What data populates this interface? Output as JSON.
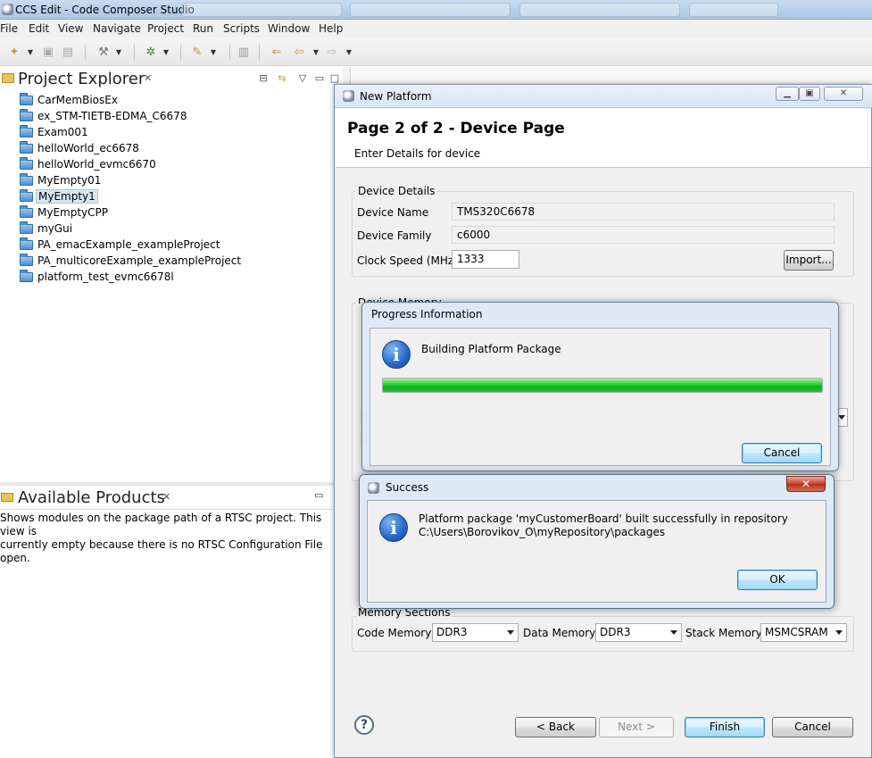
{
  "window": {
    "title": "CCS Edit - Code Composer Studio"
  },
  "menu": [
    "File",
    "Edit",
    "View",
    "Navigate",
    "Project",
    "Run",
    "Scripts",
    "Window",
    "Help"
  ],
  "project_explorer": {
    "title": "Project Explorer",
    "items": [
      "CarMemBiosEx",
      "ex_STM-TIETB-EDMA_C6678",
      "Exam001",
      "helloWorld_ec6678",
      "helloWorld_evmc6670",
      "MyEmpty01",
      "MyEmpty1",
      "MyEmptyCPP",
      "myGui",
      "PA_emacExample_exampleProject",
      "PA_multicoreExample_exampleProject",
      "platform_test_evmc6678l"
    ],
    "selected_index": 6
  },
  "available_products": {
    "title": "Available Products",
    "message_line1": "Shows modules on the package path of a RTSC project. This view is",
    "message_line2": "currently empty because there is no RTSC Configuration File open."
  },
  "new_platform": {
    "title": "New Platform",
    "page_heading": "Page 2 of 2 - Device Page",
    "page_subtitle": "Enter Details for device",
    "device_details": {
      "group_label": "Device Details",
      "device_name_label": "Device Name",
      "device_name_value": "TMS320C6678",
      "device_family_label": "Device Family",
      "device_family_value": "c6000",
      "clock_speed_label": "Clock Speed (MHz)",
      "clock_speed_value": "1333",
      "import_button": "Import..."
    },
    "device_memory_label": "Device Memory",
    "memory_sections": {
      "group_label": "Memory Sections",
      "code_memory_label": "Code Memory:",
      "code_memory_value": "DDR3",
      "data_memory_label": "Data Memory:",
      "data_memory_value": "DDR3",
      "stack_memory_label": "Stack Memory:",
      "stack_memory_value": "MSMCSRAM"
    },
    "buttons": {
      "back": "< Back",
      "next": "Next >",
      "finish": "Finish",
      "cancel": "Cancel"
    }
  },
  "progress_dialog": {
    "title": "Progress Information",
    "message": "Building Platform Package",
    "progress_fraction": 1.0,
    "cancel_button": "Cancel"
  },
  "success_dialog": {
    "title": "Success",
    "message_line1": "Platform package 'myCustomerBoard' built successfully in repository",
    "message_line2": "C:\\Users\\Borovikov_O\\myRepository\\packages",
    "ok_button": "OK",
    "close_glyph": "✕"
  },
  "colors": {
    "progress_green": "#06b025",
    "selection": "#d9e6f4"
  }
}
